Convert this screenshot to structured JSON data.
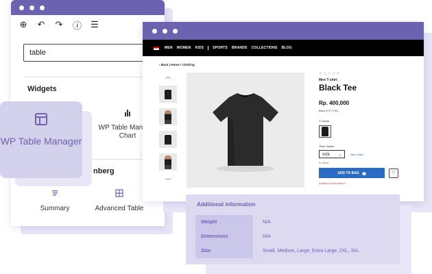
{
  "editor": {
    "toolbar": [
      {
        "name": "add-block-icon",
        "glyph": "⊕"
      },
      {
        "name": "undo-icon",
        "glyph": "↶"
      },
      {
        "name": "redo-icon",
        "glyph": "↷"
      },
      {
        "name": "info-icon",
        "glyph": "ⓘ"
      },
      {
        "name": "list-view-icon",
        "glyph": "☰"
      }
    ],
    "search_value": "table",
    "widgets_heading": "Widgets",
    "chart_block_label": "WP Table Manager Chart",
    "section2_heading": "nberg",
    "blocks": [
      {
        "label": "Summary",
        "icon": "summary-icon"
      },
      {
        "label": "Advanced Table",
        "icon": "table-grid-icon"
      }
    ]
  },
  "wp_card": {
    "label": "WP Table Manager",
    "icon": "table-icon"
  },
  "shop": {
    "nav": [
      "MEN",
      "WOMEN",
      "KIDS",
      "SPORTS",
      "BRANDS",
      "COLLECTIONS",
      "BLOG"
    ],
    "breadcrumb": "‹  Back  |  Home / Clothing",
    "product": {
      "stars": "☆☆☆☆☆",
      "category": "Men T-shirt",
      "name": "Black Tee",
      "price": "Rp. 400,000",
      "variant": "Black (CF7726)",
      "colors_label": "1 Colors",
      "size_label": "*Size Option",
      "size_value": "SIZE",
      "size_chart": "Size Chart",
      "stock": "In Stock",
      "add_to_bag": "ADD TO BAG",
      "additional_link": "Additional Information"
    }
  },
  "additional_info": {
    "title": "Additional information",
    "rows": [
      {
        "key": "Weight",
        "value": "N/A"
      },
      {
        "key": "Dimensions",
        "value": "N/A"
      },
      {
        "key": "Size",
        "value": "Small, Medium, Large, Extra Large, 2XL, 3XL"
      }
    ]
  },
  "colors": {
    "accent": "#6b63b0",
    "card_bg": "#d4d1ec",
    "button_blue": "#2a6cc4",
    "nav_bg": "#000000"
  }
}
